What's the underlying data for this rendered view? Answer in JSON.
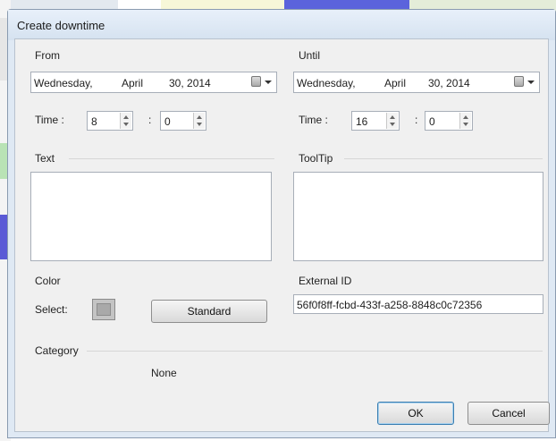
{
  "dialog": {
    "title": "Create downtime"
  },
  "from": {
    "label": "From",
    "date": {
      "weekday": "Wednesday,",
      "month": "April",
      "day_year": "30, 2014"
    },
    "time_label": "Time :",
    "hour": "8",
    "minute": "0"
  },
  "until": {
    "label": "Until",
    "date": {
      "weekday": "Wednesday,",
      "month": "April",
      "day_year": "30, 2014"
    },
    "time_label": "Time :",
    "hour": "16",
    "minute": "0"
  },
  "time_separator": ":",
  "text": {
    "label": "Text",
    "value": ""
  },
  "tooltip": {
    "label": "ToolTip",
    "value": ""
  },
  "color": {
    "label": "Color",
    "select_label": "Select:",
    "standard_button": "Standard",
    "swatch": "#a9a9a9"
  },
  "external_id": {
    "label": "External ID",
    "value": "56f0f8ff-fcbd-433f-a258-8848c0c72356"
  },
  "category": {
    "label": "Category",
    "value": "None"
  },
  "buttons": {
    "ok": "OK",
    "cancel": "Cancel"
  }
}
